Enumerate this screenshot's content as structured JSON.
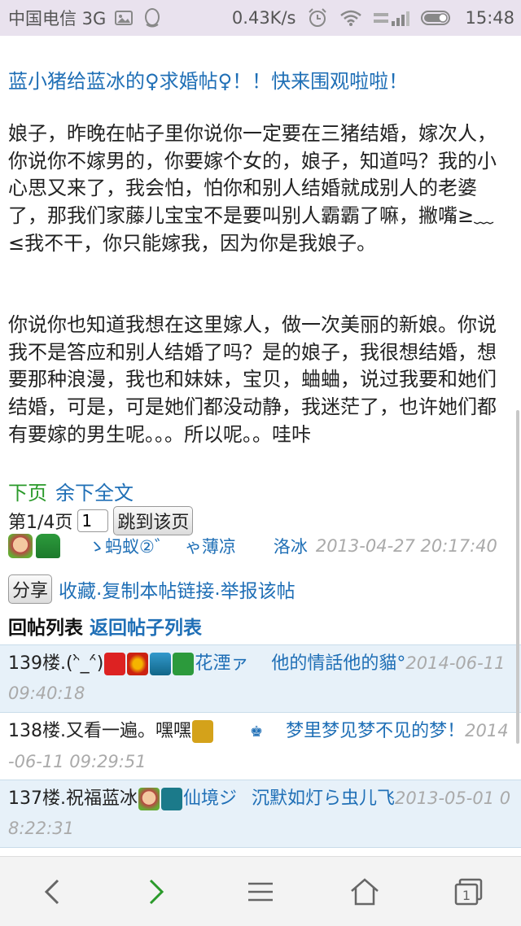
{
  "status": {
    "carrier": "中国电信 3G",
    "speed": "0.43K/s",
    "time": "15:48"
  },
  "post": {
    "title": "蓝小猪给蓝冰的♀求婚帖♀！！快来围观啦啦！",
    "paragraph1": "娘子，昨晚在帖子里你说你一定要在三猪结婚，嫁次人，你说你不嫁男的，你要嫁个女的，娘子，知道吗？我的小心思又来了，我会怕，怕你和别人结婚就成别人的老婆了，那我们家藤儿宝宝不是要叫别人霸霸了嘛，撇嘴≥﹏≤我不干，你只能嫁我，因为你是我娘子。",
    "paragraph2": "你说你也知道我想在这里嫁人，做一次美丽的新娘。你说我不是答应和别人结婚了吗？是的娘子，我很想结婚，想要那种浪漫，我也和妹妹，宝贝，蛐蛐，说过我要和她们结婚，可是，可是她们都没动静，我迷茫了，也许她们都有要嫁的男生呢。。。所以呢。。哇咔"
  },
  "pager": {
    "next_label": "下页",
    "rest_label": "余下全文",
    "page_info": "第1/4页",
    "page_value": "1",
    "jump_label": "跳到该页"
  },
  "author": {
    "name1": "ゝ蚂蚁②゛",
    "name2": "ゃ薄凉",
    "name3": "洛冰",
    "timestamp": "2013-04-27 20:17:40"
  },
  "actions": {
    "share_label": "分享",
    "favorite": "收藏",
    "copy_link": "复制本帖链接",
    "report": "举报该帖",
    "sep": "."
  },
  "reply_header": {
    "title": "回帖列表",
    "back_link": "返回帖子列表"
  },
  "replies": [
    {
      "floor": "139楼.(ᵔ̀_ᵔ́)",
      "user": "花湮ァ",
      "content": "他的情話他的貓°",
      "timestamp": "2014-06-11 09:40:18"
    },
    {
      "floor": "138楼.又看一遍。嘿嘿",
      "user": "梦里梦见梦不见的梦！",
      "timestamp": "2014-06-11 09:29:51"
    },
    {
      "floor": "137楼.祝福蓝冰",
      "user": "仙境ジ",
      "content": "沉默如灯ら虫儿飞",
      "timestamp": "2013-05-01 08:22:31"
    }
  ],
  "colors": {
    "link": "#1f6fb6",
    "green_link": "#2a9a2a",
    "status_bar": "#e9e2ee",
    "reply_shade": "#e7f1f9"
  }
}
